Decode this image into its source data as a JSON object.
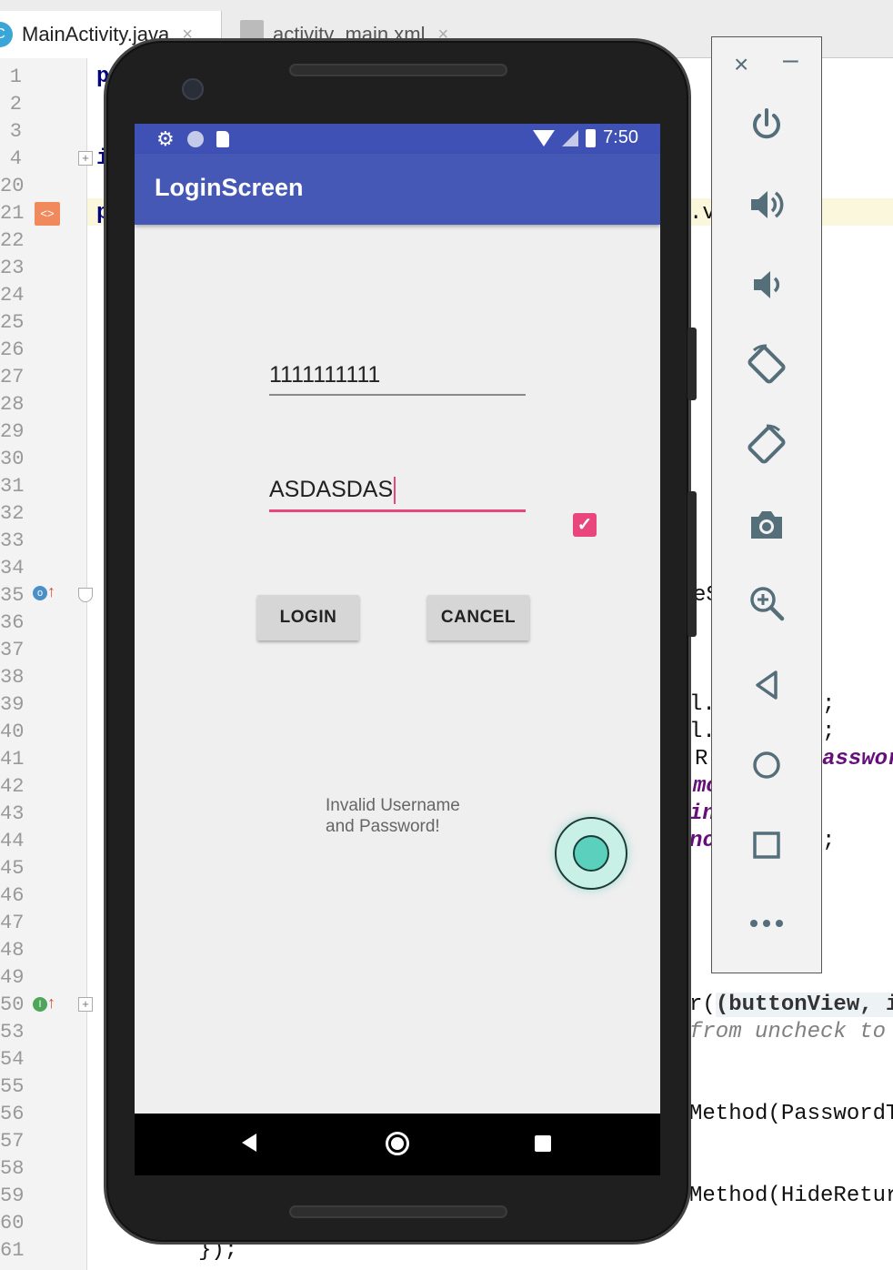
{
  "ide": {
    "tabs": [
      {
        "label": "MainActivity.java",
        "icon": "C"
      },
      {
        "label": "activity_main.xml"
      }
    ],
    "close_glyph": "×",
    "line_numbers": [
      "1",
      "2",
      "3",
      "4",
      "20",
      "21",
      "22",
      "23",
      "24",
      "25",
      "26",
      "27",
      "28",
      "29",
      "30",
      "31",
      "32",
      "33",
      "34",
      "35",
      "36",
      "37",
      "38",
      "39",
      "40",
      "41",
      "42",
      "43",
      "44",
      "45",
      "46",
      "47",
      "48",
      "49",
      "50",
      "53",
      "54",
      "55",
      "56",
      "57",
      "58",
      "59",
      "60",
      "61"
    ],
    "code_fragments": {
      "line1": "p",
      "line4": "i",
      "line21": "p",
      "line21_right": ".v:",
      "line35_right": "eS",
      "line39_a": "l.",
      "line39_b": ";",
      "line40_a": "l.",
      "line40_b": ";",
      "line41_a": "R",
      "line41_b": "asswor",
      "line42": "mo",
      "line43": "inl",
      "line44_a": "nc",
      "line44_b": ";",
      "line50": "r(",
      "line50_param": "(buttonView, is",
      "line53": "from uncheck to c",
      "line56": "Method(PasswordTr",
      "line59": "Method(HideReturn",
      "line61": "});"
    }
  },
  "app": {
    "status_time": "7:50",
    "title": "LoginScreen",
    "username_value": "1111111111",
    "password_value": "ASDASDAS",
    "checkbox_checked": true,
    "login_label": "LOGIN",
    "cancel_label": "CANCEL",
    "message_line1": "Invalid Username",
    "message_line2": "and Password!",
    "colors": {
      "primary": "#4558b5",
      "status_bar": "#3f51b5",
      "accent": "#e8467c"
    }
  },
  "emulator_toolbar": {
    "close_glyph": "×",
    "minimize_glyph": "–",
    "items": [
      "power-icon",
      "volume-up-icon",
      "volume-down-icon",
      "rotate-left-icon",
      "rotate-right-icon",
      "camera-icon",
      "zoom-icon",
      "back-icon",
      "home-icon",
      "overview-icon",
      "more-icon"
    ]
  }
}
